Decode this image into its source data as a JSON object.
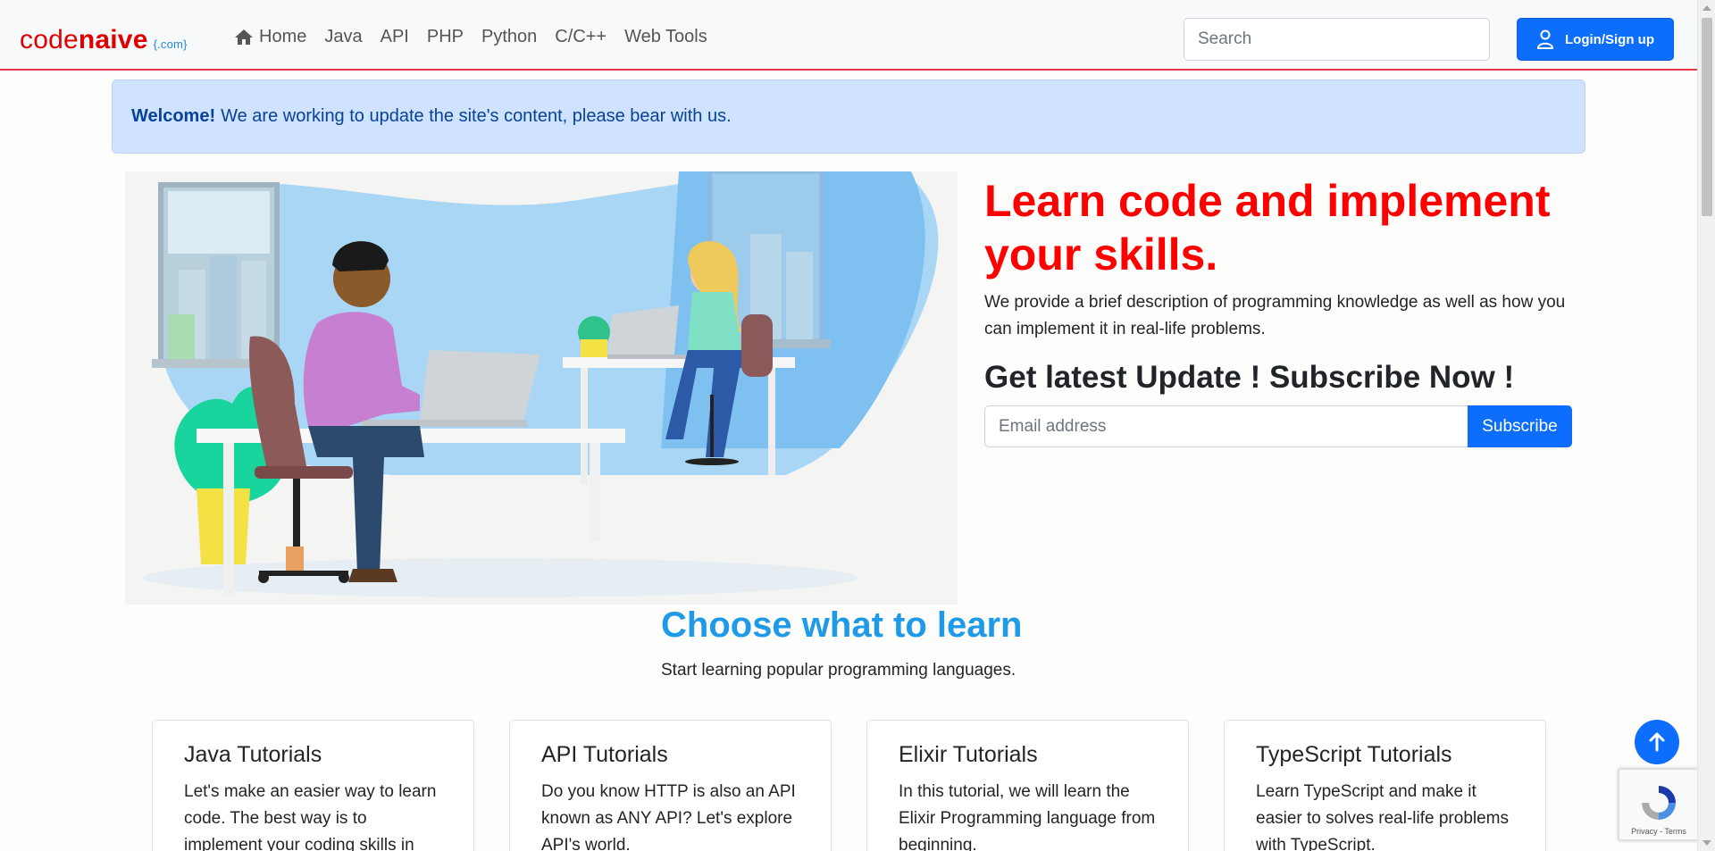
{
  "brand": {
    "code": "code",
    "naive": "naive",
    "domain": "{.com}"
  },
  "nav": {
    "items": [
      {
        "label": "Home",
        "icon": "home-icon"
      },
      {
        "label": "Java"
      },
      {
        "label": "API"
      },
      {
        "label": "PHP"
      },
      {
        "label": "Python"
      },
      {
        "label": "C/C++"
      },
      {
        "label": "Web Tools"
      }
    ],
    "search_placeholder": "Search",
    "login_label": "Login/Sign up",
    "login_icon": "user-icon"
  },
  "alert": {
    "strong": "Welcome!",
    "text": "We are working to update the site's content, please bear with us."
  },
  "hero": {
    "title": "Learn code and implement your skills.",
    "description": "We provide a brief description of programming knowledge as well as how you can implement it in real-life problems.",
    "subscribe_heading": "Get latest Update ! Subscribe Now !",
    "email_placeholder": "Email address",
    "subscribe_label": "Subscribe"
  },
  "section": {
    "title": "Choose what to learn",
    "subtitle": "Start learning popular programming languages."
  },
  "cards": [
    {
      "title": "Java Tutorials",
      "text": "Let's make an easier way to learn code. The best way is to implement your coding skills in"
    },
    {
      "title": "API Tutorials",
      "text": "Do you know HTTP is also an API known as ANY API? Let's explore API's world."
    },
    {
      "title": "Elixir Tutorials",
      "text": "In this tutorial, we will learn the Elixir Programming language from beginning."
    },
    {
      "title": "TypeScript Tutorials",
      "text": "Learn TypeScript and make it easier to solves real-life problems with TypeScript."
    }
  ],
  "recaptcha": {
    "text": "Privacy - Terms"
  },
  "colors": {
    "accent": "#0d6efd",
    "brand_red": "#e00000",
    "hero_title": "#ff0000",
    "section_title": "#1e9ae8",
    "alert_bg": "#cfe2ff"
  }
}
